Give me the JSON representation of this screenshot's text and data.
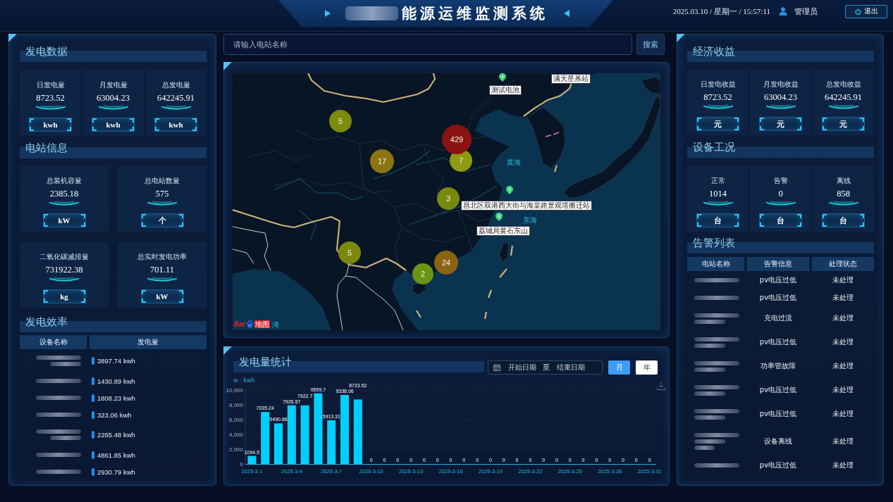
{
  "header": {
    "title_redacted": true,
    "title": "能源运维监测系统",
    "datetime": "2025.03.10 / 星期一 / 15:57:11",
    "user": "管理员",
    "logout": "退出"
  },
  "generation_data": {
    "title": "发电数据",
    "cards": [
      {
        "label": "日发电量",
        "value": "8723.52",
        "unit": "kwh"
      },
      {
        "label": "月发电量",
        "value": "63004.23",
        "unit": "kwh"
      },
      {
        "label": "总发电量",
        "value": "642245.91",
        "unit": "kwh"
      }
    ]
  },
  "station_info": {
    "title": "电站信息",
    "cards": [
      {
        "label": "总装机容量",
        "value": "2385.18",
        "unit": "kW"
      },
      {
        "label": "总电站数量",
        "value": "575",
        "unit": "个"
      },
      {
        "label": "二氧化碳减排量",
        "value": "731922.38",
        "unit": "kg"
      },
      {
        "label": "总实时发电功率",
        "value": "701.11",
        "unit": "kW"
      }
    ]
  },
  "generation_efficiency": {
    "title": "发电效率",
    "columns": [
      "设备名称",
      "发电量"
    ],
    "rows": [
      {
        "kind": "double",
        "value": "3897.74 kwh"
      },
      {
        "kind": "single",
        "value": "1430.89 kwh"
      },
      {
        "kind": "single",
        "value": "1808.23 kwh"
      },
      {
        "kind": "single",
        "value": "323.06 kwh"
      },
      {
        "kind": "double",
        "value": "2265.48 kwh"
      },
      {
        "kind": "single",
        "value": "4861.85 kwh"
      },
      {
        "kind": "single",
        "value": "2930.79 kwh"
      }
    ]
  },
  "search": {
    "placeholder": "请输入电站名称",
    "button": "搜索"
  },
  "map": {
    "clusters": [
      {
        "count": "5",
        "color": "#7c8a0e"
      },
      {
        "count": "17",
        "color": "#8c7412"
      },
      {
        "count": "7",
        "color": "#8e9a10"
      },
      {
        "count": "429",
        "color": "#8b1212"
      },
      {
        "count": "3",
        "color": "#778a0e"
      },
      {
        "count": "5",
        "color": "#7a880c"
      },
      {
        "count": "24",
        "color": "#8a6412"
      },
      {
        "count": "2",
        "color": "#6c9414"
      }
    ],
    "stations": [
      {
        "label": "满天星基站",
        "pin": false
      },
      {
        "label": "测试电池",
        "pin": true
      },
      {
        "label": "昌北区双港西大街与海棠路景观塔搬迁站",
        "pin": true
      },
      {
        "label": "荔城局黄石东山",
        "pin": true
      }
    ],
    "sea_labels": [
      "黄海",
      "东海",
      "湾"
    ],
    "logo": {
      "brand_left": "Bai",
      "brand_right": "地图"
    }
  },
  "power_chart": {
    "title": "发电量统计",
    "date_range": {
      "start_placeholder": "开始日期",
      "separator": "至",
      "end_placeholder": "结束日期"
    },
    "periods": [
      {
        "label": "月",
        "selected": true
      },
      {
        "label": "年",
        "selected": false
      }
    ],
    "chart_data": {
      "type": "bar",
      "ylabel": "w · kwh",
      "categories": [
        "2025-3-1",
        null,
        null,
        "2025-3-4",
        null,
        null,
        "2025-3-7",
        null,
        null,
        "2025-3-10",
        null,
        null,
        "2025-3-13",
        null,
        null,
        "2025-3-16",
        null,
        null,
        "2025-3-19",
        null,
        null,
        "2025-3-22",
        null,
        null,
        "2025-3-25",
        null,
        null,
        "2025-3-28",
        null,
        null,
        "2025-3-31"
      ],
      "values": [
        1094.5,
        7035.24,
        5490.66,
        7926.57,
        7922.7,
        9559.7,
        5913.31,
        9338.06,
        8723.52,
        0,
        0,
        0,
        0,
        0,
        0,
        0,
        0,
        0,
        0,
        0,
        0,
        0,
        0,
        0,
        0,
        0,
        0,
        0,
        0,
        0,
        0
      ],
      "ylim": [
        0,
        10000
      ],
      "yticks": [
        {
          "value": 0,
          "label": "0"
        },
        {
          "value": 2000,
          "label": "2,000"
        },
        {
          "value": 4000,
          "label": "4,000"
        },
        {
          "value": 6000,
          "label": "6,000"
        },
        {
          "value": 8000,
          "label": "8,000"
        },
        {
          "value": 10000,
          "label": "10,000"
        }
      ],
      "grid": true,
      "data_labels": true
    }
  },
  "economic_income": {
    "title": "经济收益",
    "cards": [
      {
        "label": "日发电收益",
        "value": "8723.52",
        "unit": "元"
      },
      {
        "label": "月发电收益",
        "value": "63004.23",
        "unit": "元"
      },
      {
        "label": "总发电收益",
        "value": "642245.91",
        "unit": "元"
      }
    ]
  },
  "equipment_status": {
    "title": "设备工况",
    "cards": [
      {
        "label": "正常",
        "value": "1014",
        "unit": "台"
      },
      {
        "label": "告警",
        "value": "0",
        "unit": "台"
      },
      {
        "label": "离线",
        "value": "858",
        "unit": "台"
      }
    ]
  },
  "alarm_list": {
    "title": "告警列表",
    "columns": [
      "电站名称",
      "告警信息",
      "处理状态"
    ],
    "rows": [
      {
        "kind": "single",
        "info": "pv电压过低",
        "status": "未处理"
      },
      {
        "kind": "single",
        "info": "pv电压过低",
        "status": "未处理"
      },
      {
        "kind": "double",
        "info": "充电过流",
        "status": "未处理"
      },
      {
        "kind": "double",
        "info": "pv电压过低",
        "status": "未处理"
      },
      {
        "kind": "double",
        "info": "功率管故障",
        "status": "未处理"
      },
      {
        "kind": "double",
        "info": "pv电压过低",
        "status": "未处理"
      },
      {
        "kind": "double",
        "info": "pv电压过低",
        "status": "未处理"
      },
      {
        "kind": "triple",
        "info": "设备离线",
        "status": "未处理"
      },
      {
        "kind": "single",
        "info": "pv电压过低",
        "status": "未处理"
      }
    ]
  }
}
